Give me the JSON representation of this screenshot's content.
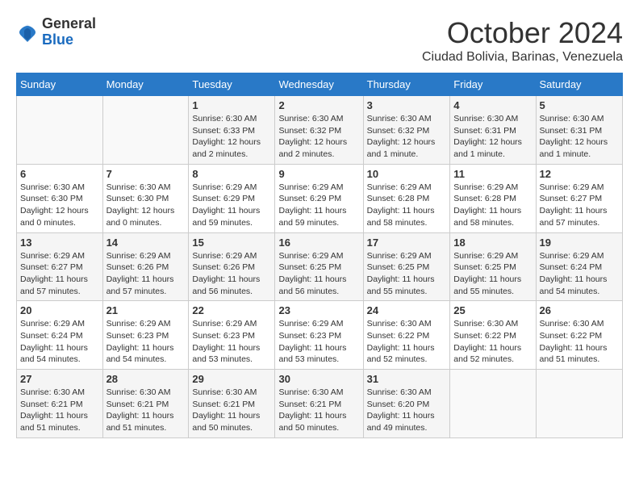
{
  "logo": {
    "general": "General",
    "blue": "Blue"
  },
  "title": "October 2024",
  "subtitle": "Ciudad Bolivia, Barinas, Venezuela",
  "days_of_week": [
    "Sunday",
    "Monday",
    "Tuesday",
    "Wednesday",
    "Thursday",
    "Friday",
    "Saturday"
  ],
  "weeks": [
    [
      {
        "day": "",
        "info": ""
      },
      {
        "day": "",
        "info": ""
      },
      {
        "day": "1",
        "info": "Sunrise: 6:30 AM\nSunset: 6:33 PM\nDaylight: 12 hours and 2 minutes."
      },
      {
        "day": "2",
        "info": "Sunrise: 6:30 AM\nSunset: 6:32 PM\nDaylight: 12 hours and 2 minutes."
      },
      {
        "day": "3",
        "info": "Sunrise: 6:30 AM\nSunset: 6:32 PM\nDaylight: 12 hours and 1 minute."
      },
      {
        "day": "4",
        "info": "Sunrise: 6:30 AM\nSunset: 6:31 PM\nDaylight: 12 hours and 1 minute."
      },
      {
        "day": "5",
        "info": "Sunrise: 6:30 AM\nSunset: 6:31 PM\nDaylight: 12 hours and 1 minute."
      }
    ],
    [
      {
        "day": "6",
        "info": "Sunrise: 6:30 AM\nSunset: 6:30 PM\nDaylight: 12 hours and 0 minutes."
      },
      {
        "day": "7",
        "info": "Sunrise: 6:30 AM\nSunset: 6:30 PM\nDaylight: 12 hours and 0 minutes."
      },
      {
        "day": "8",
        "info": "Sunrise: 6:29 AM\nSunset: 6:29 PM\nDaylight: 11 hours and 59 minutes."
      },
      {
        "day": "9",
        "info": "Sunrise: 6:29 AM\nSunset: 6:29 PM\nDaylight: 11 hours and 59 minutes."
      },
      {
        "day": "10",
        "info": "Sunrise: 6:29 AM\nSunset: 6:28 PM\nDaylight: 11 hours and 58 minutes."
      },
      {
        "day": "11",
        "info": "Sunrise: 6:29 AM\nSunset: 6:28 PM\nDaylight: 11 hours and 58 minutes."
      },
      {
        "day": "12",
        "info": "Sunrise: 6:29 AM\nSunset: 6:27 PM\nDaylight: 11 hours and 57 minutes."
      }
    ],
    [
      {
        "day": "13",
        "info": "Sunrise: 6:29 AM\nSunset: 6:27 PM\nDaylight: 11 hours and 57 minutes."
      },
      {
        "day": "14",
        "info": "Sunrise: 6:29 AM\nSunset: 6:26 PM\nDaylight: 11 hours and 57 minutes."
      },
      {
        "day": "15",
        "info": "Sunrise: 6:29 AM\nSunset: 6:26 PM\nDaylight: 11 hours and 56 minutes."
      },
      {
        "day": "16",
        "info": "Sunrise: 6:29 AM\nSunset: 6:25 PM\nDaylight: 11 hours and 56 minutes."
      },
      {
        "day": "17",
        "info": "Sunrise: 6:29 AM\nSunset: 6:25 PM\nDaylight: 11 hours and 55 minutes."
      },
      {
        "day": "18",
        "info": "Sunrise: 6:29 AM\nSunset: 6:25 PM\nDaylight: 11 hours and 55 minutes."
      },
      {
        "day": "19",
        "info": "Sunrise: 6:29 AM\nSunset: 6:24 PM\nDaylight: 11 hours and 54 minutes."
      }
    ],
    [
      {
        "day": "20",
        "info": "Sunrise: 6:29 AM\nSunset: 6:24 PM\nDaylight: 11 hours and 54 minutes."
      },
      {
        "day": "21",
        "info": "Sunrise: 6:29 AM\nSunset: 6:23 PM\nDaylight: 11 hours and 54 minutes."
      },
      {
        "day": "22",
        "info": "Sunrise: 6:29 AM\nSunset: 6:23 PM\nDaylight: 11 hours and 53 minutes."
      },
      {
        "day": "23",
        "info": "Sunrise: 6:29 AM\nSunset: 6:23 PM\nDaylight: 11 hours and 53 minutes."
      },
      {
        "day": "24",
        "info": "Sunrise: 6:30 AM\nSunset: 6:22 PM\nDaylight: 11 hours and 52 minutes."
      },
      {
        "day": "25",
        "info": "Sunrise: 6:30 AM\nSunset: 6:22 PM\nDaylight: 11 hours and 52 minutes."
      },
      {
        "day": "26",
        "info": "Sunrise: 6:30 AM\nSunset: 6:22 PM\nDaylight: 11 hours and 51 minutes."
      }
    ],
    [
      {
        "day": "27",
        "info": "Sunrise: 6:30 AM\nSunset: 6:21 PM\nDaylight: 11 hours and 51 minutes."
      },
      {
        "day": "28",
        "info": "Sunrise: 6:30 AM\nSunset: 6:21 PM\nDaylight: 11 hours and 51 minutes."
      },
      {
        "day": "29",
        "info": "Sunrise: 6:30 AM\nSunset: 6:21 PM\nDaylight: 11 hours and 50 minutes."
      },
      {
        "day": "30",
        "info": "Sunrise: 6:30 AM\nSunset: 6:21 PM\nDaylight: 11 hours and 50 minutes."
      },
      {
        "day": "31",
        "info": "Sunrise: 6:30 AM\nSunset: 6:20 PM\nDaylight: 11 hours and 49 minutes."
      },
      {
        "day": "",
        "info": ""
      },
      {
        "day": "",
        "info": ""
      }
    ]
  ]
}
